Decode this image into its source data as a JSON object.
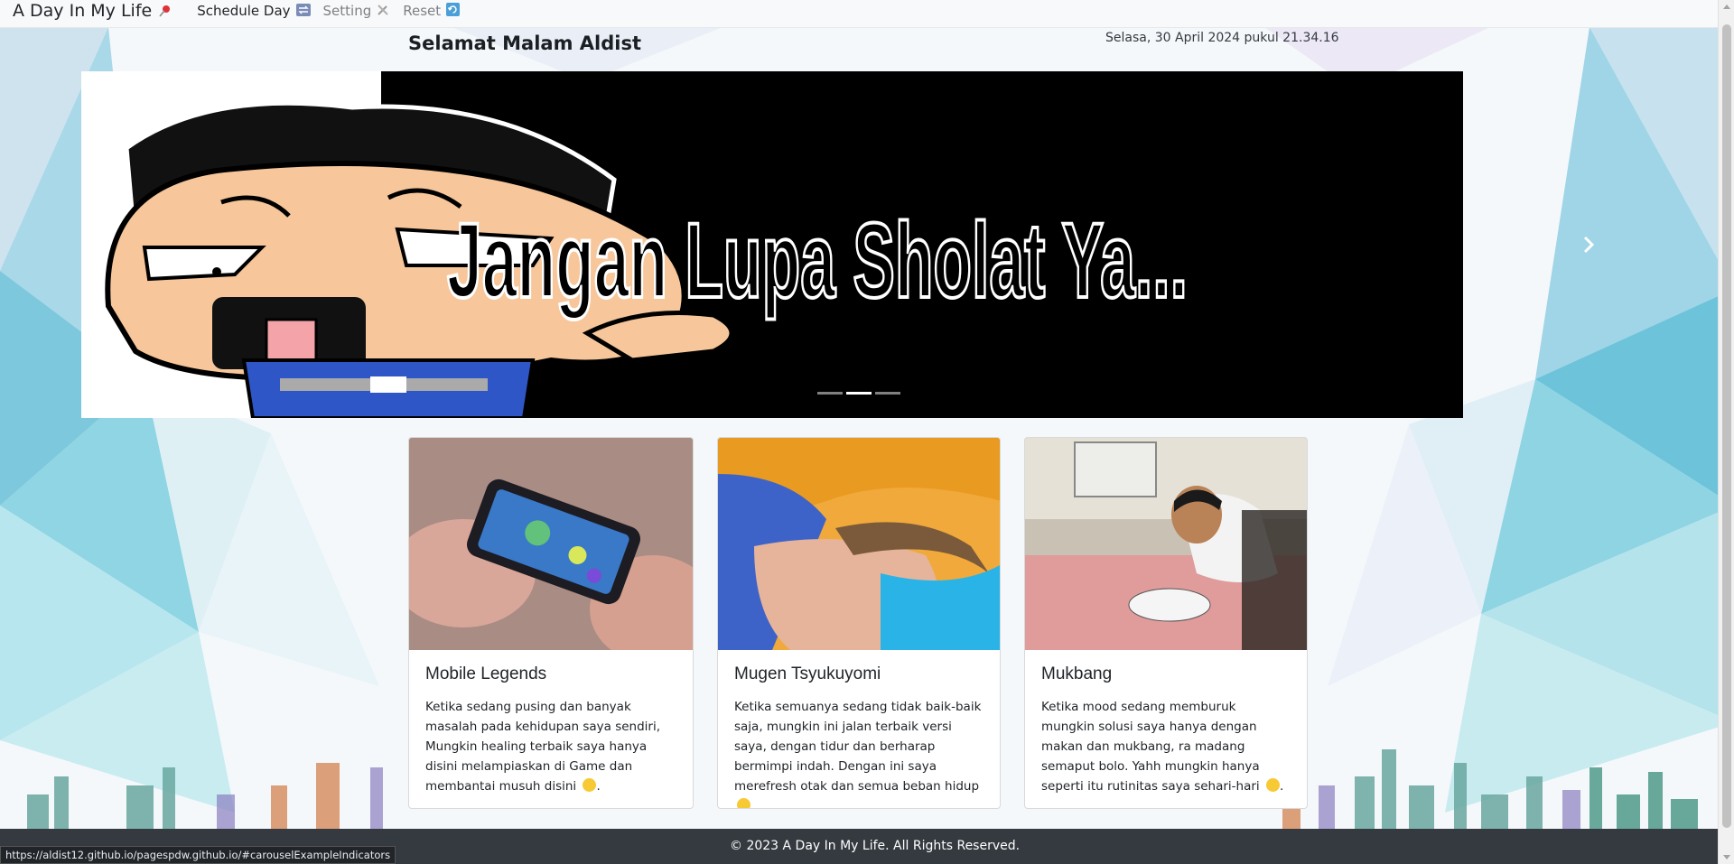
{
  "navbar": {
    "brand": "A Day In My Life",
    "brand_icon": "pushpin-icon",
    "links": [
      {
        "label": "Schedule Day",
        "icon": "soon-arrows-icon"
      },
      {
        "label": "Setting",
        "icon": "hammer-wrench-icon"
      },
      {
        "label": "Reset",
        "icon": "refresh-icon"
      }
    ]
  },
  "header": {
    "greeting": "Selamat Malam Aldist",
    "datetime": "Selasa, 30 April 2024 pukul 21.34.16"
  },
  "carousel": {
    "slide_text": "Jangan Lupa Sholat Ya...",
    "indicator_count": 3,
    "active_index": 1
  },
  "cards": [
    {
      "title": "Mobile Legends",
      "text": "Ketika sedang pusing dan banyak masalah pada kehidupan saya sendiri, Mungkin healing terbaik saya hanya disini melampiaskan di Game dan membantai musuh disini",
      "emoji": "laughing-face-icon"
    },
    {
      "title": "Mugen Tsyukuyomi",
      "text": "Ketika semuanya sedang tidak baik-baik saja, mungkin ini jalan terbaik versi saya, dengan tidur dan berharap bermimpi indah. Dengan ini saya merefresh otak dan semua beban hidup",
      "emoji": "laughing-face-icon"
    },
    {
      "title": "Mukbang",
      "text": "Ketika mood sedang memburuk mungkin solusi saya hanya dengan makan dan mukbang, ra madang semaput bolo. Yahh mungkin hanya seperti itu rutinitas saya sehari-hari",
      "emoji": "smiling-face-icon"
    }
  ],
  "footer": {
    "text": "© 2023 A Day In My Life. All Rights Reserved."
  },
  "status_url": "https://aldist12.github.io/pagespdw.github.io/#carouselExampleIndicators",
  "colors": {
    "navbar_bg": "#f8f9fa",
    "footer_bg": "#343a40",
    "carousel_bg": "#000000"
  }
}
